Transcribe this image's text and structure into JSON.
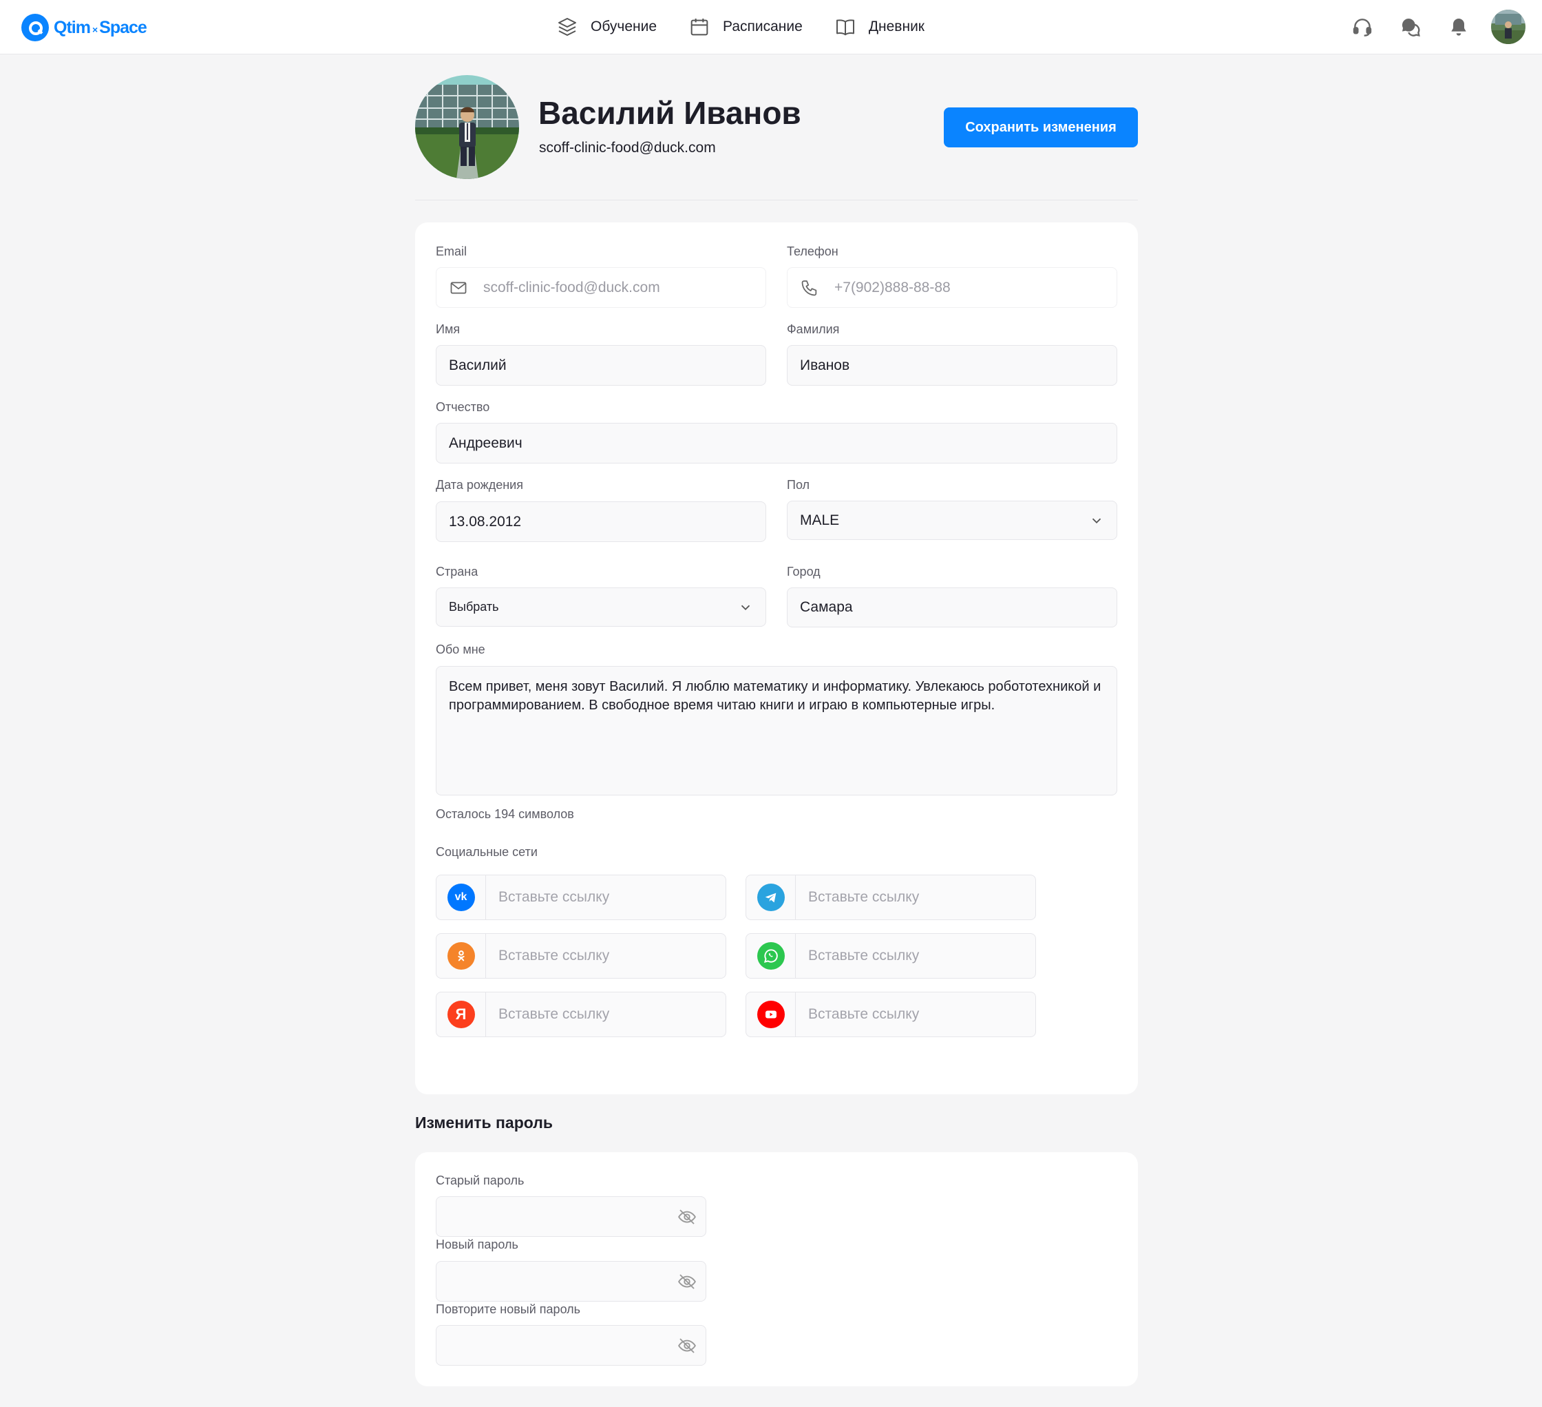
{
  "header": {
    "logo": {
      "brand_left": "Qtim",
      "separator": "×",
      "brand_right": "Space"
    },
    "nav": [
      {
        "label": "Обучение",
        "icon": "layers-icon"
      },
      {
        "label": "Расписание",
        "icon": "calendar-icon"
      },
      {
        "label": "Дневник",
        "icon": "book-icon"
      }
    ],
    "icons": [
      "headset-icon",
      "chat-icon",
      "bell-icon",
      "avatar"
    ]
  },
  "profile": {
    "name": "Василий Иванов",
    "email": "scoff-clinic-food@duck.com",
    "save_label": "Сохранить изменения"
  },
  "form": {
    "email": {
      "label": "Email",
      "value": "scoff-clinic-food@duck.com",
      "icon": "mail-icon"
    },
    "phone": {
      "label": "Телефон",
      "value": "+7(902)888-88-88",
      "icon": "phone-icon"
    },
    "first_name": {
      "label": "Имя",
      "value": "Василий"
    },
    "last_name": {
      "label": "Фамилия",
      "value": "Иванов"
    },
    "patronymic": {
      "label": "Отчество",
      "value": "Андреевич"
    },
    "birth_date": {
      "label": "Дата рождения",
      "value": "13.08.2012"
    },
    "gender": {
      "label": "Пол",
      "value": "MALE"
    },
    "country": {
      "label": "Страна",
      "value": "Выбрать"
    },
    "city": {
      "label": "Город",
      "value": "Самара"
    },
    "about": {
      "label": "Обо мне",
      "value": "Всем привет, меня зовут Василий. Я люблю математику и информатику. Увлекаюсь робототехникой и программированием. В свободное время читаю книги и играю в компьютерные игры.",
      "counter": "Осталось 194 символов"
    },
    "social": {
      "label": "Социальные сети",
      "items": [
        {
          "network": "vk",
          "icon": "vk-icon",
          "glyph": "vk",
          "color": "#0077ff",
          "placeholder": "Вставьте ссылку"
        },
        {
          "network": "telegram",
          "icon": "telegram-icon",
          "glyph": "",
          "color": "#2aa3df",
          "placeholder": "Вставьте ссылку"
        },
        {
          "network": "odnoklassniki",
          "icon": "odnoklassniki-icon",
          "glyph": "ok",
          "color": "#f5842a",
          "placeholder": "Вставьте ссылку"
        },
        {
          "network": "whatsapp",
          "icon": "whatsapp-icon",
          "glyph": "",
          "color": "#2cc74f",
          "placeholder": "Вставьте ссылку"
        },
        {
          "network": "yandex",
          "icon": "yandex-icon",
          "glyph": "Я",
          "color": "#fc3f1d",
          "placeholder": "Вставьте ссылку"
        },
        {
          "network": "youtube",
          "icon": "youtube-icon",
          "glyph": "",
          "color": "#ff0000",
          "placeholder": "Вставьте ссылку"
        }
      ]
    }
  },
  "password": {
    "title": "Изменить пароль",
    "old_label": "Старый пароль",
    "new_label": "Новый пароль",
    "repeat_label": "Повторите новый пароль"
  },
  "colors": {
    "accent": "#0a84ff",
    "background": "#f5f5f6",
    "card": "#ffffff"
  }
}
